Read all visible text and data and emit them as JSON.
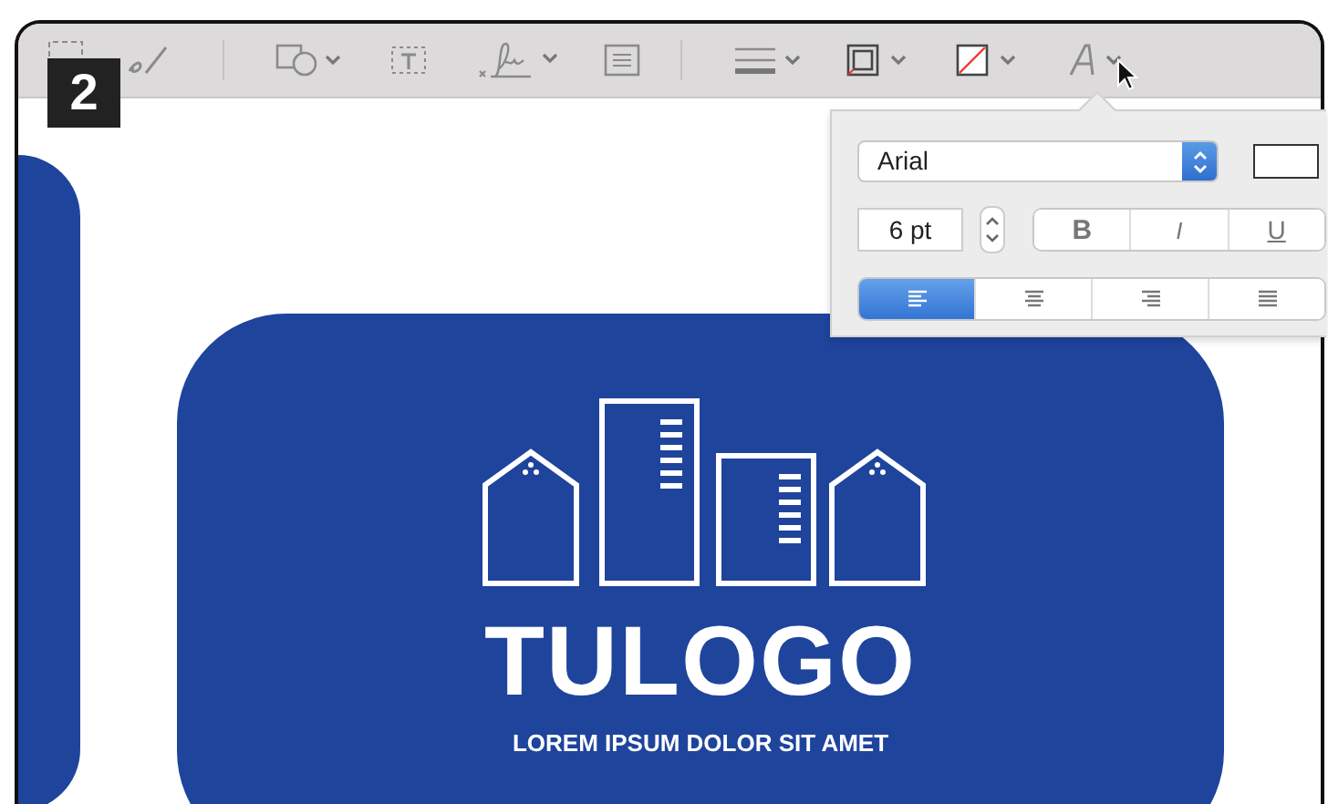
{
  "step_badge": "2",
  "toolbar": {
    "items": [
      {
        "kind": "select"
      },
      {
        "kind": "sketch"
      },
      {
        "kind": "sep"
      },
      {
        "kind": "shapes"
      },
      {
        "kind": "textbox"
      },
      {
        "kind": "sign"
      },
      {
        "kind": "note"
      },
      {
        "kind": "sep"
      },
      {
        "kind": "lines"
      },
      {
        "kind": "border"
      },
      {
        "kind": "fill"
      },
      {
        "kind": "font"
      }
    ]
  },
  "font_popover": {
    "font": "Arial",
    "size": "6 pt",
    "styles": [
      {
        "label": "B",
        "kind": "bold",
        "selected": false
      },
      {
        "label": "I",
        "kind": "italic",
        "selected": false
      },
      {
        "label": "U",
        "kind": "underline",
        "selected": false
      }
    ],
    "alignments": [
      {
        "kind": "left",
        "selected": true
      },
      {
        "kind": "center",
        "selected": false
      },
      {
        "kind": "right",
        "selected": false
      },
      {
        "kind": "justify",
        "selected": false
      }
    ]
  },
  "logo": {
    "title": "TULOGO",
    "tagline": "LOREM IPSUM DOLOR SIT AMET"
  }
}
